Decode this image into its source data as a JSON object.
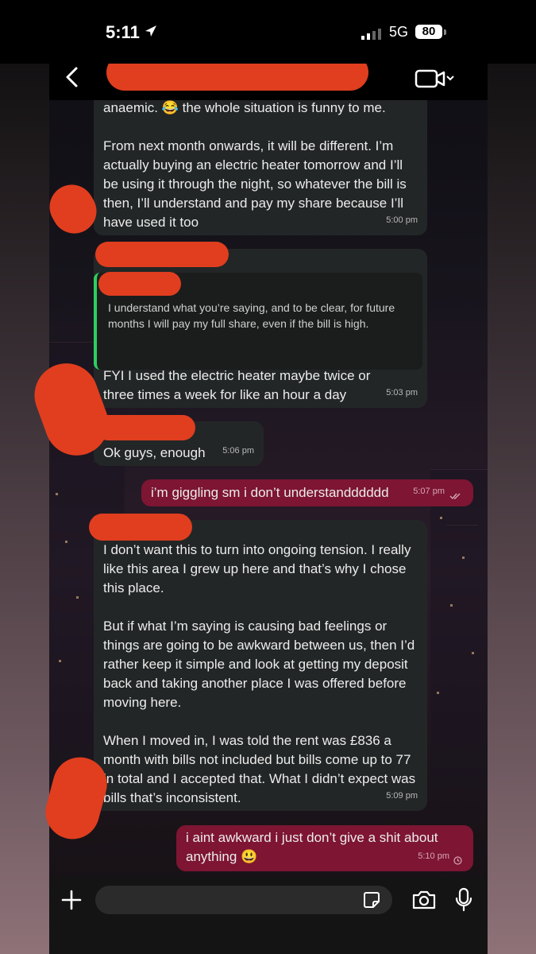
{
  "status": {
    "time": "5:11",
    "network": "5G",
    "battery": "80"
  },
  "messages": [
    {
      "text": "anaemic. 😂 the whole situation is funny to me.\n\nFrom next month onwards, it will be different. I’m actually buying an electric heater tomorrow and I’ll be using it through the night, so whatever the bill is then, I’ll understand and pay my share because I’ll have used it too",
      "time": "5:00 pm"
    },
    {
      "quote": "I understand what you’re saying, and to be clear, for future months I will pay my full share, even if the bill is high.",
      "text": "FYI I used the electric heater maybe twice or three times a week for like an hour a day",
      "time": "5:03 pm"
    },
    {
      "text": "Ok guys, enough",
      "time": "5:06 pm"
    },
    {
      "text": "i’m giggling sm i don’t understandddddd",
      "time": "5:07 pm"
    },
    {
      "text": "I don’t want this to turn into ongoing tension. I really like this area I grew up here and that’s why I chose this place.\n\nBut if what I’m saying is causing bad feelings or things are going to be awkward between us, then I’d rather keep it simple and look at getting my deposit back and taking another place I was offered before moving here.\n\nWhen I moved in, I was told the rent was £836 a month with bills not included but bills come up to 77 in total and I accepted that. What I didn’t expect was bills that’s inconsistent.",
      "time": "5:09 pm"
    },
    {
      "text": "i aint awkward i just don’t give a shit about anything 😃",
      "time": "5:10 pm"
    }
  ]
}
